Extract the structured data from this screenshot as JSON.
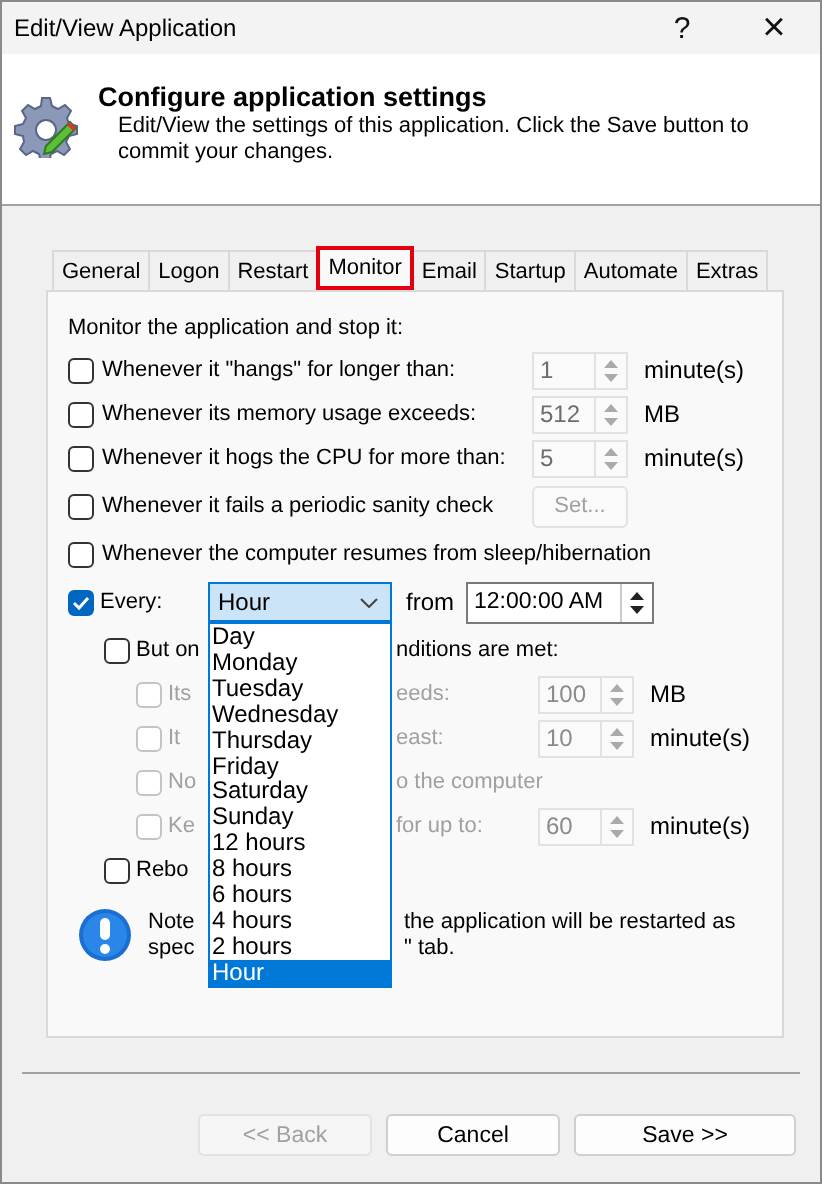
{
  "window": {
    "title": "Edit/View Application",
    "help": "?",
    "close": "×"
  },
  "header": {
    "title": "Configure application settings",
    "subtitle": "Edit/View the settings of this application. Click the Save button to commit your changes."
  },
  "tabs": [
    {
      "label": "General",
      "selected": false,
      "outlined": false
    },
    {
      "label": "Logon",
      "selected": false,
      "outlined": false
    },
    {
      "label": "Restart",
      "selected": false,
      "outlined": false
    },
    {
      "label": "Monitor",
      "selected": true,
      "outlined": true
    },
    {
      "label": "Email",
      "selected": false,
      "outlined": false
    },
    {
      "label": "Startup",
      "selected": false,
      "outlined": false
    },
    {
      "label": "Automate",
      "selected": false,
      "outlined": false
    },
    {
      "label": "Extras",
      "selected": false,
      "outlined": false
    }
  ],
  "monitor": {
    "heading": "Monitor the application and stop it:",
    "conditions": [
      {
        "kind": "spin",
        "label": "Whenever it \"hangs\" for longer than:",
        "checked": false,
        "value": "1",
        "unit": "minute(s)"
      },
      {
        "kind": "spin",
        "label": "Whenever its memory usage exceeds:",
        "checked": false,
        "value": "512",
        "unit": "MB"
      },
      {
        "kind": "spin",
        "label": "Whenever it hogs the CPU for more than:",
        "checked": false,
        "value": "5",
        "unit": "minute(s)"
      },
      {
        "kind": "button",
        "label": "Whenever it fails a periodic sanity check",
        "checked": false,
        "button": "Set..."
      },
      {
        "kind": "plain",
        "label": "Whenever the computer resumes from sleep/hibernation",
        "checked": false
      }
    ],
    "every": {
      "checked": true,
      "label": "Every:",
      "value": "Hour",
      "from_label": "from",
      "time": "12:00:00 AM",
      "options": [
        {
          "label": "Day",
          "selected": false
        },
        {
          "label": "Monday",
          "selected": false
        },
        {
          "label": "Tuesday",
          "selected": false
        },
        {
          "label": "Wednesday",
          "selected": false
        },
        {
          "label": "Thursday",
          "selected": false
        },
        {
          "label": "Friday",
          "selected": false
        },
        {
          "label": "Saturday",
          "selected": false
        },
        {
          "label": "Sunday",
          "selected": false
        },
        {
          "label": "12 hours",
          "selected": false
        },
        {
          "label": "8 hours",
          "selected": false
        },
        {
          "label": "6 hours",
          "selected": false
        },
        {
          "label": "4 hours",
          "selected": false
        },
        {
          "label": "2 hours",
          "selected": false
        },
        {
          "label": "Hour",
          "selected": true
        }
      ]
    },
    "only_if": {
      "checked": false,
      "label_start": "But on",
      "label_end": "nditions are met:",
      "items": [
        {
          "kind": "spin",
          "checked": false,
          "disabled": true,
          "label_start": "Its",
          "label_end": "eeds:",
          "value": "100",
          "unit": "MB"
        },
        {
          "kind": "spin",
          "checked": false,
          "disabled": true,
          "label_start": "It",
          "label_end": "east:",
          "value": "10",
          "unit": "minute(s)"
        },
        {
          "kind": "plain",
          "checked": false,
          "disabled": true,
          "label_start": "No",
          "label_end": "o the computer"
        },
        {
          "kind": "spin",
          "checked": false,
          "disabled": true,
          "label_start": "Ke",
          "label_end": "for up to:",
          "value": "60",
          "unit": "minute(s)"
        }
      ]
    },
    "reboot": {
      "checked": false,
      "label": "Rebo"
    },
    "note": {
      "lines": [
        {
          "start": "Note",
          "end": "the application will be restarted as"
        },
        {
          "start": "spec",
          "end": "\" tab."
        }
      ]
    }
  },
  "buttons": [
    {
      "label": "<< Back",
      "disabled": true
    },
    {
      "label": "Cancel",
      "disabled": false
    },
    {
      "label": "Save >>",
      "disabled": false
    }
  ]
}
